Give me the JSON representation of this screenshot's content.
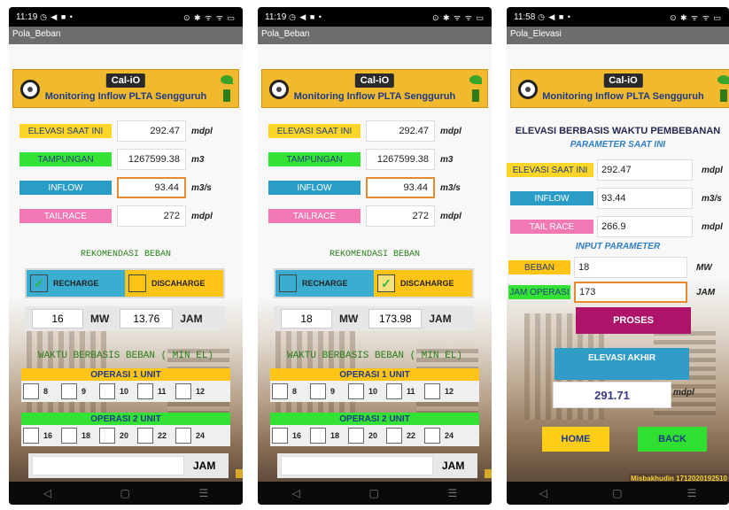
{
  "screens": [
    {
      "status_time": "11:19",
      "status_icons": "◷ ◀ ■ •",
      "status_right": "⊙ ✱ ᯤ ᯤ ▭",
      "app_title": "Pola_Beban",
      "banner": {
        "badge": "Cal-iO",
        "title": "Monitoring Inflow PLTA Sengguruh"
      },
      "fields": [
        {
          "label": "ELEVASI SAAT INI",
          "value": "292.47",
          "unit": "mdpl"
        },
        {
          "label": "TAMPUNGAN",
          "value": "1267599.38",
          "unit": "m3"
        },
        {
          "label": "INFLOW",
          "value": "93.44",
          "unit": "m3/s"
        },
        {
          "label": "TAILRACE",
          "value": "272",
          "unit": "mdpl"
        }
      ],
      "rekomendasi": "REKOMENDASI BEBAN",
      "recharge": {
        "label": "RECHARGE",
        "checked": true,
        "mark": "✓"
      },
      "discharge": {
        "label": "DISCAHARGE",
        "checked": false,
        "mark": ""
      },
      "mw_value": "16",
      "mw_unit": "MW",
      "jam_value": "13.76",
      "jam_unit": "JAM",
      "waktu_title": "WAKTU BERBASIS BEBAN ( MIN EL)",
      "op1_label": "OPERASI 1 UNIT",
      "op1_hours": [
        "8",
        "9",
        "10",
        "11",
        "12"
      ],
      "op2_label": "OPERASI 2 UNIT",
      "op2_hours": [
        "16",
        "18",
        "20",
        "22",
        "24"
      ],
      "bottom_jam": "JAM"
    },
    {
      "status_time": "11:19",
      "status_icons": "◷ ◀ ■ •",
      "status_right": "⊙ ✱ ᯤ ᯤ ▭",
      "app_title": "Pola_Beban",
      "banner": {
        "badge": "Cal-iO",
        "title": "Monitoring Inflow PLTA Sengguruh"
      },
      "fields": [
        {
          "label": "ELEVASI SAAT INI",
          "value": "292.47",
          "unit": "mdpl"
        },
        {
          "label": "TAMPUNGAN",
          "value": "1267599.38",
          "unit": "m3"
        },
        {
          "label": "INFLOW",
          "value": "93.44",
          "unit": "m3/s"
        },
        {
          "label": "TAILRACE",
          "value": "272",
          "unit": "mdpl"
        }
      ],
      "rekomendasi": "REKOMENDASI BEBAN",
      "recharge": {
        "label": "RECHARGE",
        "checked": false,
        "mark": ""
      },
      "discharge": {
        "label": "DISCAHARGE",
        "checked": true,
        "mark": "✓"
      },
      "mw_value": "18",
      "mw_unit": "MW",
      "jam_value": "173.98",
      "jam_unit": "JAM",
      "waktu_title": "WAKTU BERBASIS BEBAN ( MIN EL)",
      "op1_label": "OPERASI 1 UNIT",
      "op1_hours": [
        "8",
        "9",
        "10",
        "11",
        "12"
      ],
      "op2_label": "OPERASI 2 UNIT",
      "op2_hours": [
        "16",
        "18",
        "20",
        "22",
        "24"
      ],
      "bottom_jam": "JAM"
    },
    {
      "status_time": "11:58",
      "status_icons": "◷ ◀ ■ •",
      "status_right": "⊙ ✱ ᯤ ᯤ ▭",
      "app_title": "Pola_Elevasi",
      "banner": {
        "badge": "Cal-iO",
        "title": "Monitoring Inflow PLTA Sengguruh"
      },
      "title": "ELEVASI BERBASIS WAKTU PEMBEBANAN",
      "param_now": "PARAMETER SAAT INI",
      "fields": [
        {
          "label": "ELEVASI SAAT INI",
          "value": "292.47",
          "unit": "mdpl"
        },
        {
          "label": "INFLOW",
          "value": "93.44",
          "unit": "m3/s"
        },
        {
          "label": "TAIL RACE",
          "value": "266.9",
          "unit": "mdpl"
        }
      ],
      "input_param": "INPUT PARAMETER",
      "beban": {
        "label": "BEBAN",
        "value": "18",
        "unit": "MW"
      },
      "jam_operasi": {
        "label": "JAM OPERASI",
        "value": "173",
        "unit": "JAM"
      },
      "proses": "PROSES",
      "elevasi_akhir_label": "ELEVASI AKHIR",
      "elevasi_akhir_value": "291.71",
      "elevasi_akhir_unit": "mdpl",
      "home": "HOME",
      "back": "BACK",
      "credit": "Misbakhudin 1712020192510"
    }
  ],
  "nav": {
    "back": "◁",
    "home": "▢",
    "menu": "☰"
  },
  "colors": {
    "banner": "#f1ba2e",
    "elevasi": "#fbd626",
    "tampungan": "#33e235",
    "inflow": "#2a9cc8",
    "tailrace": "#f278b4",
    "proses": "#ad1469"
  }
}
